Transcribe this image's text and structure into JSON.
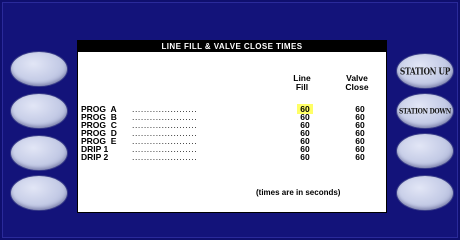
{
  "screen": {
    "title": "LINE FILL & VALVE CLOSE TIMES",
    "columns": {
      "fill": [
        "Line",
        "Fill"
      ],
      "close": [
        "Valve",
        "Close"
      ]
    },
    "rows": [
      {
        "name": "PROG  A",
        "dots": "......................",
        "fill": "60",
        "close": "60"
      },
      {
        "name": "PROG  B",
        "dots": "......................",
        "fill": "60",
        "close": "60"
      },
      {
        "name": "PROG  C",
        "dots": "......................",
        "fill": "60",
        "close": "60"
      },
      {
        "name": "PROG  D",
        "dots": "......................",
        "fill": "60",
        "close": "60"
      },
      {
        "name": "PROG  E",
        "dots": "......................",
        "fill": "60",
        "close": "60"
      },
      {
        "name": "DRIP 1",
        "dots": "......................",
        "fill": "60",
        "close": "60"
      },
      {
        "name": "DRIP 2",
        "dots": "......................",
        "fill": "60",
        "close": "60"
      }
    ],
    "selected_cell": "PROG A / Line Fill",
    "footnote": "(times are in seconds)"
  },
  "softkeys": {
    "right_1": "STATION UP",
    "right_2": "STATION DOWN"
  },
  "colors": {
    "background": "#0f0f6e",
    "highlight": "#ffff66"
  }
}
